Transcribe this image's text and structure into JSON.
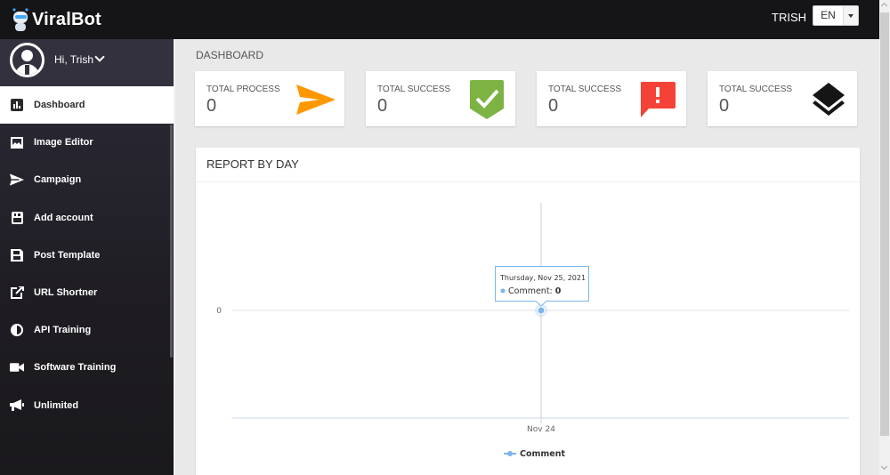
{
  "app": {
    "brand": "ViralBot",
    "user_name": "TRISH",
    "language": "EN"
  },
  "sidebar": {
    "greeting": "Hi, Trish",
    "items": [
      {
        "label": "Dashboard",
        "icon": "bar-chart-icon",
        "active": true
      },
      {
        "label": "Image Editor",
        "icon": "image-icon",
        "active": false
      },
      {
        "label": "Campaign",
        "icon": "paper-plane-icon",
        "active": false
      },
      {
        "label": "Add account",
        "icon": "youtube-icon",
        "active": false
      },
      {
        "label": "Post Template",
        "icon": "floppy-disk-icon",
        "active": false
      },
      {
        "label": "URL Shortner",
        "icon": "external-link-icon",
        "active": false
      },
      {
        "label": "API Training",
        "icon": "half-circle-icon",
        "active": false
      },
      {
        "label": "Software Training",
        "icon": "video-camera-icon",
        "active": false
      },
      {
        "label": "Unlimited",
        "icon": "megaphone-icon",
        "active": false
      }
    ]
  },
  "main": {
    "page_title": "DASHBOARD",
    "cards": [
      {
        "label": "TOTAL PROCESS",
        "value": "0",
        "icon": "send-arrow-icon",
        "color": "#ff9800"
      },
      {
        "label": "TOTAL SUCCESS",
        "value": "0",
        "icon": "shield-check-icon",
        "color": "#7cb342"
      },
      {
        "label": "TOTAL SUCCESS",
        "value": "0",
        "icon": "alert-comment-icon",
        "color": "#f44336"
      },
      {
        "label": "TOTAL SUCCESS",
        "value": "0",
        "icon": "layers-icon",
        "color": "#151515"
      }
    ],
    "report_title": "REPORT BY DAY"
  },
  "chart_data": {
    "type": "line",
    "title": "",
    "xlabel": "",
    "ylabel": "",
    "categories": [
      "Nov 24"
    ],
    "x_ticks": [
      "Nov 24"
    ],
    "y_ticks": [
      "0"
    ],
    "series": [
      {
        "name": "Comment",
        "color": "#7cb5ec",
        "points": [
          {
            "x": "Thursday, Nov 25, 2021",
            "y": 0
          }
        ]
      }
    ],
    "tooltip": {
      "date": "Thursday, Nov 25, 2021",
      "series_label": "Comment:",
      "value": "0"
    },
    "legend": "bottom-center",
    "grid": true
  }
}
